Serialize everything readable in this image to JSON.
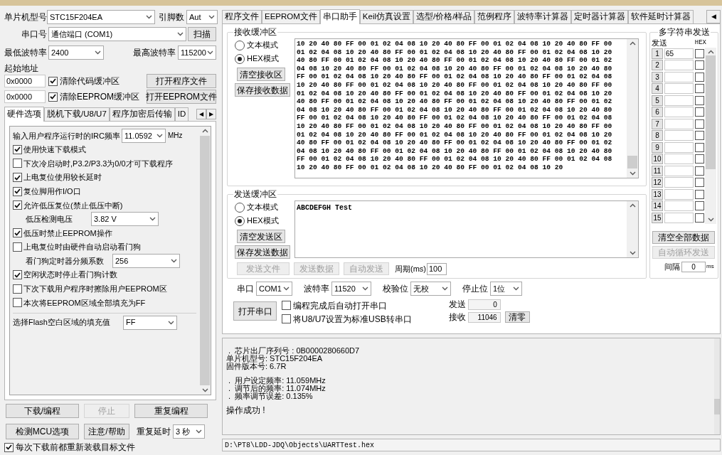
{
  "left": {
    "model": {
      "label": "单片机型号",
      "value": "STC15F204EA"
    },
    "pins": {
      "label": "引脚数",
      "value": "Aut"
    },
    "port": {
      "label": "串口号",
      "value": "通信端口 (COM1)"
    },
    "scan_button": "扫描",
    "min_baud": {
      "label": "最低波特率",
      "value": "2400"
    },
    "max_baud": {
      "label": "最高波特率",
      "value": "115200"
    },
    "start_address_label": "起始地址",
    "address_rows": [
      {
        "address": "0x0000",
        "label": "清除代码缓冲区",
        "checked": true,
        "button": "打开程序文件"
      },
      {
        "address": "0x0000",
        "label": "清除EEPROM缓冲区",
        "checked": true,
        "button": "打开EEPROM文件"
      }
    ],
    "tabs": [
      {
        "label": "硬件选项",
        "selected": true
      },
      {
        "label": "脱机下载/U8/U7",
        "selected": false
      },
      {
        "label": "程序加密后传输",
        "selected": false
      },
      {
        "label": "ID",
        "selected": false
      }
    ],
    "tab_scroll": [
      "◀",
      "▶"
    ],
    "options": [
      {
        "kind": "select",
        "label": "输入用户程序运行时的IRC频率",
        "value": "11.0592",
        "unit": "MHz"
      },
      {
        "kind": "checkbox",
        "label": "使用快速下载模式",
        "checked": true
      },
      {
        "kind": "checkbox",
        "label": "下次冷启动时,P3.2/P3.3为0/0才可下载程序",
        "checked": false
      },
      {
        "kind": "checkbox",
        "label": "上电复位使用较长延时",
        "checked": true
      },
      {
        "kind": "checkbox",
        "label": "复位脚用作I/O口",
        "checked": true
      },
      {
        "kind": "checkbox",
        "label": "允许低压复位(禁止低压中断)",
        "checked": true
      },
      {
        "kind": "subselect",
        "label": "低压检测电压",
        "value": "3.82 V"
      },
      {
        "kind": "checkbox",
        "label": "低压时禁止EEPROM操作",
        "checked": true
      },
      {
        "kind": "checkbox",
        "label": "上电复位时由硬件自动启动看门狗",
        "checked": false
      },
      {
        "kind": "subselect",
        "label": "看门狗定时器分频系数",
        "value": "256"
      },
      {
        "kind": "checkbox",
        "label": "空闲状态时停止看门狗计数",
        "checked": true
      },
      {
        "kind": "checkbox",
        "label": "下次下载用户程序时擦除用户EEPROM区",
        "checked": false
      },
      {
        "kind": "checkbox",
        "label": "本次将EEPROM区域全部填充为FF",
        "checked": false
      }
    ],
    "fill_value": {
      "label": "选择Flash空白区域的填充值",
      "value": "FF"
    },
    "actions": [
      {
        "label": "下载/编程",
        "disabled": false
      },
      {
        "label": "停止",
        "disabled": true
      },
      {
        "label": "重复编程",
        "disabled": false
      },
      {
        "label": "检测MCU选项",
        "disabled": false
      },
      {
        "label": "注意/帮助",
        "disabled": false
      }
    ],
    "repeat_delay": {
      "label": "重复延时",
      "value": "3 秒"
    },
    "reload": {
      "label": "每次下载前都重新装载目标文件",
      "checked": true
    }
  },
  "right": {
    "tabs": [
      {
        "label": "程序文件",
        "selected": false
      },
      {
        "label": "EEPROM文件",
        "selected": false
      },
      {
        "label": "串口助手",
        "selected": true
      },
      {
        "label": "Keil仿真设置",
        "selected": false
      },
      {
        "label": "选型/价格/样品",
        "selected": false
      },
      {
        "label": "范例程序",
        "selected": false
      },
      {
        "label": "波特率计算器",
        "selected": false
      },
      {
        "label": "定时器计算器",
        "selected": false
      },
      {
        "label": "软件延时计算器",
        "selected": false
      }
    ],
    "tab_scroll": "◀",
    "receive": {
      "title": "接收缓冲区",
      "modes": [
        {
          "label": "文本模式",
          "selected": false
        },
        {
          "label": "HEX模式",
          "selected": true
        }
      ],
      "buttons": [
        "清空接收区",
        "保存接收数据"
      ],
      "lines": [
        "10 20 40 80 FF 00 01 02 04 08 10 20 40 80 FF 00 01 02 04 08 10 20 40 80 FF 00",
        "01 02 04 08 10 20 40 80 FF 00 01 02 04 08 10 20 40 80 FF 00 01 02 04 08 10 20",
        "40 80 FF 00 01 02 04 08 10 20 40 80 FF 00 01 02 04 08 10 20 40 80 FF 00 01 02",
        "04 08 10 20 40 80 FF 00 01 02 04 08 10 20 40 80 FF 00 01 02 04 08 10 20 40 80",
        "FF 00 01 02 04 08 10 20 40 80 FF 00 01 02 04 08 10 20 40 80 FF 00 01 02 04 08",
        "10 20 40 80 FF 00 01 02 04 08 10 20 40 80 FF 00 01 02 04 08 10 20 40 80 FF 00",
        "01 02 04 08 10 20 40 80 FF 00 01 02 04 08 10 20 40 80 FF 00 01 02 04 08 10 20",
        "40 80 FF 00 01 02 04 08 10 20 40 80 FF 00 01 02 04 08 10 20 40 80 FF 00 01 02",
        "04 08 10 20 40 80 FF 00 01 02 04 08 10 20 40 80 FF 00 01 02 04 08 10 20 40 80",
        "FF 00 01 02 04 08 10 20 40 80 FF 00 01 02 04 08 10 20 40 80 FF 00 01 02 04 08",
        "10 20 40 80 FF 00 01 02 04 08 10 20 40 80 FF 00 01 02 04 08 10 20 40 80 FF 00",
        "01 02 04 08 10 20 40 80 FF 00 01 02 04 08 10 20 40 80 FF 00 01 02 04 08 10 20",
        "40 80 FF 00 01 02 04 08 10 20 40 80 FF 00 01 02 04 08 10 20 40 80 FF 00 01 02",
        "04 08 10 20 40 80 FF 00 01 02 04 08 10 20 40 80 FF 00 01 02 04 08 10 20 40 80",
        "FF 00 01 02 04 08 10 20 40 80 FF 00 01 02 04 08 10 20 40 80 FF 00 01 02 04 08",
        "10 20 40 80 FF 00 01 02 04 08 10 20 40 80 FF 00 01 02 04 08 10 20"
      ]
    },
    "send": {
      "title": "发送缓冲区",
      "modes": [
        {
          "label": "文本模式",
          "selected": false
        },
        {
          "label": "HEX模式",
          "selected": true
        }
      ],
      "buttons": [
        "清空发送区",
        "保存发送数据"
      ],
      "text": "ABCDEFGH Test",
      "actions": [
        {
          "label": "发送文件",
          "disabled": true
        },
        {
          "label": "发送数据",
          "disabled": true
        },
        {
          "label": "自动发送",
          "disabled": true
        }
      ],
      "period": {
        "label": "周期(ms)",
        "value": "100"
      }
    },
    "multi": {
      "title": "多字符串发送",
      "send_header": "发送",
      "hex_header": "HEX",
      "rows": [
        {
          "number": "1",
          "value": "65",
          "hex": false
        },
        {
          "number": "2",
          "hex": false
        },
        {
          "number": "3",
          "hex": false
        },
        {
          "number": "4",
          "hex": false
        },
        {
          "number": "5",
          "hex": false
        },
        {
          "number": "6",
          "hex": false
        },
        {
          "number": "7",
          "hex": false
        },
        {
          "number": "8",
          "hex": false
        },
        {
          "number": "9",
          "hex": false
        },
        {
          "number": "10",
          "hex": false
        },
        {
          "number": "11",
          "hex": false
        },
        {
          "number": "12",
          "hex": false
        },
        {
          "number": "13",
          "hex": false
        },
        {
          "number": "14",
          "hex": false
        },
        {
          "number": "15",
          "hex": false
        }
      ],
      "clear_button": "清空全部数据",
      "auto_button": {
        "label": "自动循环发送",
        "disabled": true
      },
      "interval": {
        "label": "间隔",
        "value": "0",
        "unit": "ms"
      }
    },
    "serial": {
      "settings": [
        {
          "label": "串口",
          "value": "COM1"
        },
        {
          "label": "波特率",
          "value": "11520"
        },
        {
          "label": "校验位",
          "value": "无校"
        },
        {
          "label": "停止位",
          "value": "1位"
        }
      ],
      "open_button": "打开串口",
      "options": [
        {
          "label": "编程完成后自动打开串口",
          "checked": false
        },
        {
          "label": "将U8/U7设置为标准USB转串口",
          "checked": false
        }
      ],
      "sent": {
        "label": "发送",
        "value": "0"
      },
      "received": {
        "label": "接收",
        "value": "11046"
      },
      "reset_button": "清零"
    },
    "log": {
      "groups": [
        [
          " .  芯片出厂序列号 : 0B0000280660D7",
          "单片机型号: STC15F204EA",
          "固件版本号: 6.7R"
        ],
        [
          " .  用户设定频率: 11.059MHz",
          " .  调节后的频率: 11.074MHz",
          " .  频率调节误差: 0.135%"
        ]
      ],
      "status": "操作成功 !"
    },
    "path": "D:\\PT8\\LDD-JDQ\\Objects\\UARTTest.hex"
  }
}
